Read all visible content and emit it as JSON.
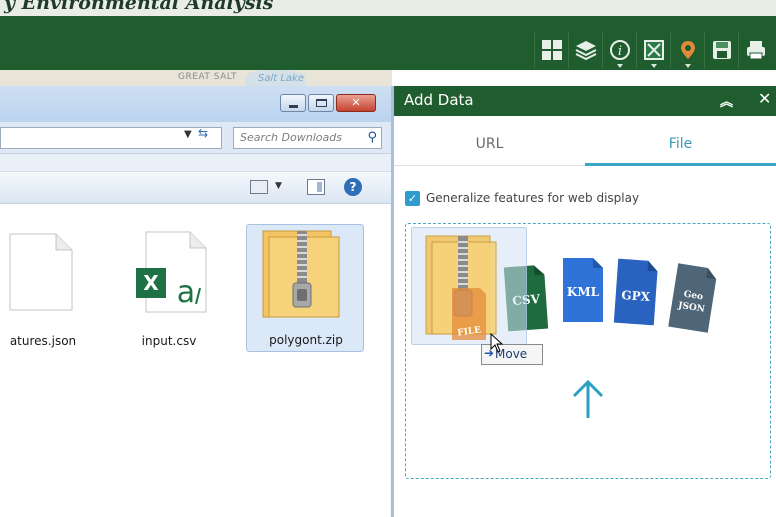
{
  "banner": {
    "title": "y Environmental Analysis",
    "tools": [
      "grid-icon",
      "layers-icon",
      "info-icon",
      "measure-icon",
      "location-icon",
      "save-icon",
      "print-icon"
    ]
  },
  "map": {
    "label_region": "GREAT SALT",
    "label_lake": "Salt Lake"
  },
  "explorer": {
    "close_glyph": "✕",
    "search_placeholder": "Search Downloads",
    "search_glyph": "⚲",
    "help_glyph": "?",
    "files": [
      {
        "name": "atures.json",
        "type": "json"
      },
      {
        "name": "input.csv",
        "type": "csv"
      },
      {
        "name": "polygont.zip",
        "type": "zip"
      }
    ]
  },
  "panel": {
    "title": "Add Data",
    "collapse_glyph": "︽",
    "close_glyph": "✕",
    "tabs": [
      {
        "label": "URL",
        "active": false
      },
      {
        "label": "File",
        "active": true
      }
    ],
    "generalize_checked": true,
    "generalize_label": "Generalize features for web display",
    "file_types": [
      {
        "label": "CSV",
        "color": "#1e6b40"
      },
      {
        "label": "KML",
        "color": "#2f73d8"
      },
      {
        "label": "GPX",
        "color": "#2a63bf"
      },
      {
        "label": "Geo JSON",
        "color": "#4f6678"
      }
    ],
    "ghost_badge": "FILE"
  },
  "drag": {
    "tooltip": "Move",
    "tooltip_glyph": "➜"
  },
  "colors": {
    "banner_green": "#1f5d2e",
    "accent_teal": "#3aa7c7",
    "checkbox_blue": "#2f9bcf"
  }
}
